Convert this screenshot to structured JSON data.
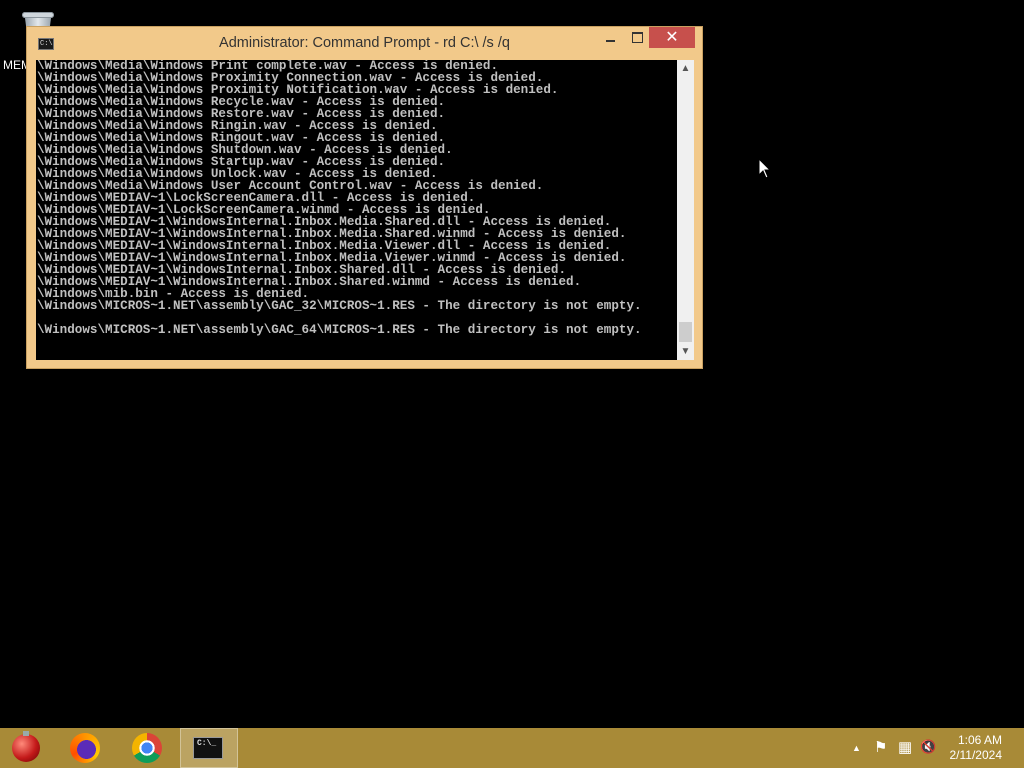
{
  "desktop": {
    "icons": [
      {
        "label": "MEM",
        "icon": "recycle-bin-icon"
      }
    ]
  },
  "window": {
    "title": "Administrator: Command Prompt - rd  C:\\ /s /q",
    "buttons": {
      "minimize": "minimize",
      "maximize": "maximize",
      "close": "✕"
    },
    "console_lines": [
      "\\Windows\\Media\\Windows Print complete.wav - Access is denied.",
      "\\Windows\\Media\\Windows Proximity Connection.wav - Access is denied.",
      "\\Windows\\Media\\Windows Proximity Notification.wav - Access is denied.",
      "\\Windows\\Media\\Windows Recycle.wav - Access is denied.",
      "\\Windows\\Media\\Windows Restore.wav - Access is denied.",
      "\\Windows\\Media\\Windows Ringin.wav - Access is denied.",
      "\\Windows\\Media\\Windows Ringout.wav - Access is denied.",
      "\\Windows\\Media\\Windows Shutdown.wav - Access is denied.",
      "\\Windows\\Media\\Windows Startup.wav - Access is denied.",
      "\\Windows\\Media\\Windows Unlock.wav - Access is denied.",
      "\\Windows\\Media\\Windows User Account Control.wav - Access is denied.",
      "\\Windows\\MEDIAV~1\\LockScreenCamera.dll - Access is denied.",
      "\\Windows\\MEDIAV~1\\LockScreenCamera.winmd - Access is denied.",
      "\\Windows\\MEDIAV~1\\WindowsInternal.Inbox.Media.Shared.dll - Access is denied.",
      "\\Windows\\MEDIAV~1\\WindowsInternal.Inbox.Media.Shared.winmd - Access is denied.",
      "\\Windows\\MEDIAV~1\\WindowsInternal.Inbox.Media.Viewer.dll - Access is denied.",
      "\\Windows\\MEDIAV~1\\WindowsInternal.Inbox.Media.Viewer.winmd - Access is denied.",
      "\\Windows\\MEDIAV~1\\WindowsInternal.Inbox.Shared.dll - Access is denied.",
      "\\Windows\\MEDIAV~1\\WindowsInternal.Inbox.Shared.winmd - Access is denied.",
      "\\Windows\\mib.bin - Access is denied.",
      "\\Windows\\MICROS~1.NET\\assembly\\GAC_32\\MICROS~1.RES - The directory is not empty.",
      "",
      "\\Windows\\MICROS~1.NET\\assembly\\GAC_64\\MICROS~1.RES - The directory is not empty."
    ]
  },
  "taskbar": {
    "apps": [
      {
        "name": "ornament-app",
        "icon": "ornament-icon"
      },
      {
        "name": "firefox",
        "icon": "firefox-icon"
      },
      {
        "name": "chrome",
        "icon": "chrome-icon"
      },
      {
        "name": "command-prompt",
        "icon": "cmd-icon",
        "label": "C:\\_",
        "active": true
      }
    ],
    "tray": {
      "chevron": "▲",
      "flag": "⚑",
      "network": "▦",
      "volume": "🔇"
    },
    "clock": {
      "time": "1:06 AM",
      "date": "2/11/2024"
    }
  }
}
